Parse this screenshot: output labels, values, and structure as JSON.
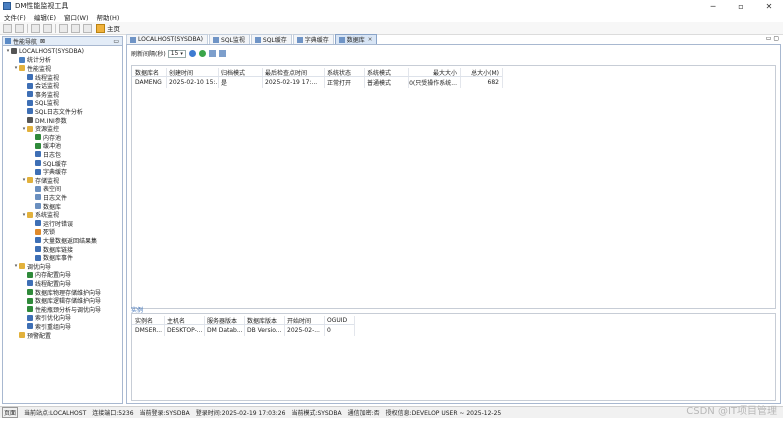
{
  "window": {
    "title": "DM性能监视工具"
  },
  "menu": [
    "文件(F)",
    "编辑(E)",
    "窗口(W)",
    "帮助(H)"
  ],
  "toolbar": {
    "home_label": "主页"
  },
  "left_panel": {
    "tab_label": "性能导航",
    "tab_suffix": "⊠"
  },
  "tree": [
    {
      "label": "LOCALHOST(SYSDBA)",
      "level": 0,
      "toggle": "▾",
      "color": "#555555"
    },
    {
      "label": "统计分析",
      "level": 1,
      "toggle": "",
      "color": "#4a7fc1"
    },
    {
      "label": "性能监视",
      "level": 1,
      "toggle": "▾",
      "color": "#e2b13c"
    },
    {
      "label": "线程监视",
      "level": 2,
      "toggle": "",
      "color": "#3e6fb5"
    },
    {
      "label": "会话监视",
      "level": 2,
      "toggle": "",
      "color": "#3e6fb5"
    },
    {
      "label": "事务监视",
      "level": 2,
      "toggle": "",
      "color": "#3e6fb5"
    },
    {
      "label": "SQL监视",
      "level": 2,
      "toggle": "",
      "color": "#3e6fb5"
    },
    {
      "label": "SQL日志文件分析",
      "level": 2,
      "toggle": "",
      "color": "#3e6fb5"
    },
    {
      "label": "DM.INI参数",
      "level": 2,
      "toggle": "",
      "color": "#555555"
    },
    {
      "label": "资源监控",
      "level": 2,
      "toggle": "▾",
      "color": "#e2b13c"
    },
    {
      "label": "内存池",
      "level": 3,
      "toggle": "",
      "color": "#2f8a3a"
    },
    {
      "label": "缓冲池",
      "level": 3,
      "toggle": "",
      "color": "#2f8a3a"
    },
    {
      "label": "日志包",
      "level": 3,
      "toggle": "",
      "color": "#3e6fb5"
    },
    {
      "label": "SQL缓存",
      "level": 3,
      "toggle": "",
      "color": "#3e6fb5"
    },
    {
      "label": "字典缓存",
      "level": 3,
      "toggle": "",
      "color": "#3e6fb5"
    },
    {
      "label": "存储监视",
      "level": 2,
      "toggle": "▾",
      "color": "#e2b13c"
    },
    {
      "label": "表空间",
      "level": 3,
      "toggle": "",
      "color": "#6a8fbf"
    },
    {
      "label": "日志文件",
      "level": 3,
      "toggle": "",
      "color": "#6a8fbf"
    },
    {
      "label": "数据库",
      "level": 3,
      "toggle": "",
      "color": "#6a8fbf"
    },
    {
      "label": "系统监视",
      "level": 2,
      "toggle": "▾",
      "color": "#e2b13c"
    },
    {
      "label": "运行时错误",
      "level": 3,
      "toggle": "",
      "color": "#3e6fb5"
    },
    {
      "label": "死锁",
      "level": 3,
      "toggle": "",
      "color": "#e08a2a"
    },
    {
      "label": "大量数据返回结果集",
      "level": 3,
      "toggle": "",
      "color": "#3e6fb5"
    },
    {
      "label": "数据库链接",
      "level": 3,
      "toggle": "",
      "color": "#3e6fb5"
    },
    {
      "label": "数据库事件",
      "level": 3,
      "toggle": "",
      "color": "#3e6fb5"
    },
    {
      "label": "调优向导",
      "level": 1,
      "toggle": "▾",
      "color": "#e2b13c"
    },
    {
      "label": "内存配置向导",
      "level": 2,
      "toggle": "",
      "color": "#2f8a3a"
    },
    {
      "label": "线程配置向导",
      "level": 2,
      "toggle": "",
      "color": "#3e6fb5"
    },
    {
      "label": "数据库物理存储维护向导",
      "level": 2,
      "toggle": "",
      "color": "#2f8a3a"
    },
    {
      "label": "数据库逻辑存储维护向导",
      "level": 2,
      "toggle": "",
      "color": "#2f8a3a"
    },
    {
      "label": "性能瓶颈分析与调优向导",
      "level": 2,
      "toggle": "",
      "color": "#2f8a3a"
    },
    {
      "label": "索引优化向导",
      "level": 2,
      "toggle": "",
      "color": "#3e6fb5"
    },
    {
      "label": "索引重组向导",
      "level": 2,
      "toggle": "",
      "color": "#3e6fb5"
    },
    {
      "label": "预警配置",
      "level": 1,
      "toggle": "",
      "color": "#e2b13c"
    }
  ],
  "editor_tabs": [
    {
      "label": "LOCALHOST(SYSDBA)",
      "active": false,
      "closable": false
    },
    {
      "label": "SQL监视",
      "active": false,
      "closable": false
    },
    {
      "label": "SQL缓存",
      "active": false,
      "closable": false
    },
    {
      "label": "字典缓存",
      "active": false,
      "closable": false
    },
    {
      "label": "数据库",
      "active": true,
      "closable": true
    }
  ],
  "refresh": {
    "label": "刷新间隔(秒)",
    "value": "15"
  },
  "db_table": {
    "columns": [
      {
        "label": "数据库名",
        "align": "left"
      },
      {
        "label": "创建时间",
        "align": "left"
      },
      {
        "label": "归档模式",
        "align": "left"
      },
      {
        "label": "最后检查点时间",
        "align": "left"
      },
      {
        "label": "系统状态",
        "align": "left"
      },
      {
        "label": "系统模式",
        "align": "left"
      },
      {
        "label": "最大大小",
        "align": "right"
      },
      {
        "label": "总大小(M)",
        "align": "right"
      }
    ],
    "rows": [
      [
        "DAMENG",
        "2025-02-10 15:...",
        "是",
        "2025-02-19 17:...",
        "正常打开",
        "普通模式",
        "0(只受操作系统...",
        "682"
      ]
    ]
  },
  "instance_section": {
    "label": "实例"
  },
  "inst_table": {
    "columns": [
      "实例名",
      "主机名",
      "服务器版本",
      "数据库版本",
      "开始时间",
      "OGUID"
    ],
    "rows": [
      [
        "DMSER...",
        "DESKTOP-...",
        "DM Datab...",
        "DB Versio...",
        "2025-02-...",
        "0"
      ]
    ]
  },
  "status": [
    "当前站点:LOCALHOST",
    "连接端口:5236",
    "当前登录:SYSDBA",
    "登录时间:2025-02-19 17:03:26",
    "当前模式:SYSDBA",
    "通信加密:否",
    "授权信息:DEVELOP USER ~ 2025-12-25"
  ],
  "watermark": "CSDN @IT项目管理"
}
